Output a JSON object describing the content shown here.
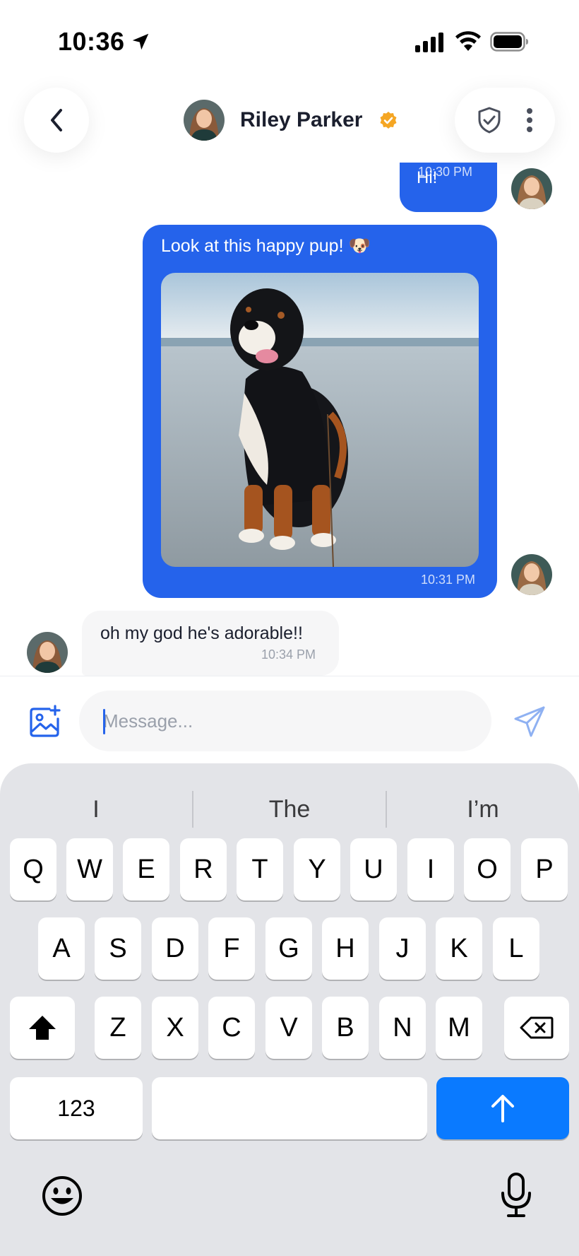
{
  "status_bar": {
    "time": "10:36"
  },
  "header": {
    "contact_name": "Riley Parker"
  },
  "messages": [
    {
      "direction": "outgoing",
      "text": "Hi!",
      "time": "10:30 PM"
    },
    {
      "direction": "outgoing",
      "text": "Look at this happy pup! 🐶",
      "time": "10:31 PM",
      "attachment": "photo of a dog on a beach"
    },
    {
      "direction": "incoming",
      "text": "oh my god he's adorable!!",
      "time": "10:34 PM"
    }
  ],
  "composer": {
    "placeholder": "Message...",
    "value": ""
  },
  "keyboard": {
    "suggestions": [
      "I",
      "The",
      "I’m"
    ],
    "row1": [
      "Q",
      "W",
      "E",
      "R",
      "T",
      "Y",
      "U",
      "I",
      "O",
      "P"
    ],
    "row2": [
      "A",
      "S",
      "D",
      "F",
      "G",
      "H",
      "J",
      "K",
      "L"
    ],
    "row3": [
      "Z",
      "X",
      "C",
      "V",
      "B",
      "N",
      "M"
    ],
    "numbers_label": "123"
  },
  "colors": {
    "accent": "#2563eb",
    "verified": "#f5a623",
    "return_key": "#0a7aff",
    "keyboard_bg": "#e3e4e8"
  },
  "icons": {
    "status": [
      "location-arrow-icon",
      "signal-icon",
      "wifi-icon",
      "battery-icon"
    ],
    "header": [
      "back-chevron-icon",
      "verified-badge-icon",
      "shield-check-icon",
      "more-vertical-icon"
    ],
    "composer": [
      "add-image-icon",
      "send-icon"
    ],
    "keyboard": [
      "shift-icon",
      "backspace-icon",
      "return-arrow-icon",
      "emoji-icon",
      "microphone-icon"
    ]
  }
}
